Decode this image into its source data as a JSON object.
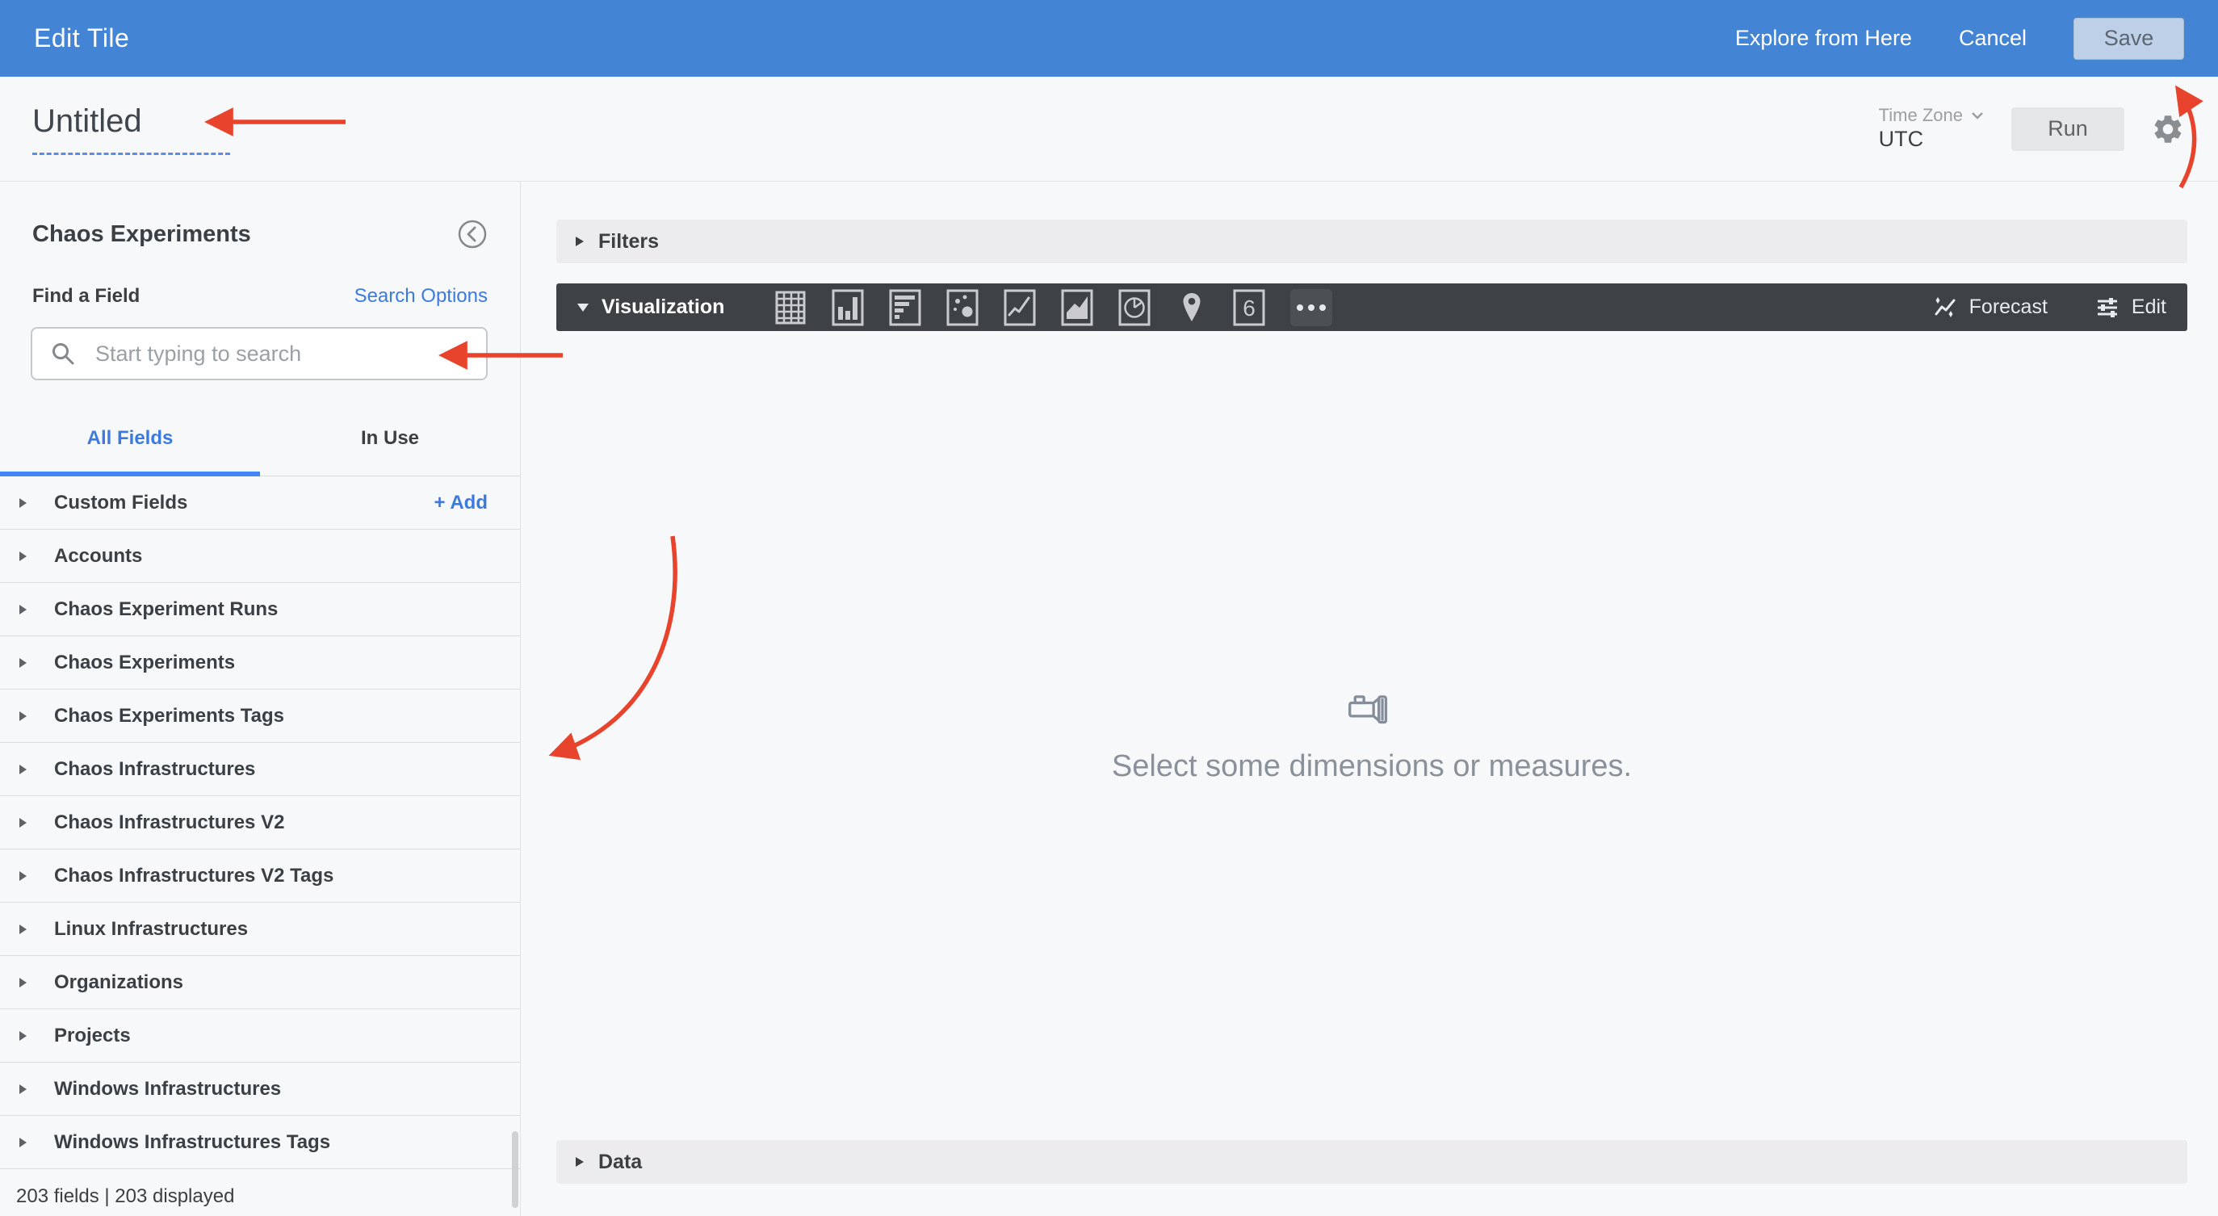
{
  "topbar": {
    "title": "Edit Tile",
    "explore_label": "Explore from Here",
    "cancel_label": "Cancel",
    "save_label": "Save"
  },
  "header": {
    "title": "Untitled",
    "timezone_label": "Time Zone",
    "timezone_value": "UTC",
    "run_label": "Run"
  },
  "sidebar": {
    "title": "Chaos Experiments",
    "find_field_label": "Find a Field",
    "search_options_label": "Search Options",
    "search_placeholder": "Start typing to search",
    "tabs": [
      {
        "label": "All Fields",
        "active": true
      },
      {
        "label": "In Use",
        "active": false
      }
    ],
    "fields": [
      {
        "label": "Custom Fields",
        "action_label": "+ Add"
      },
      {
        "label": "Accounts"
      },
      {
        "label": "Chaos Experiment Runs"
      },
      {
        "label": "Chaos Experiments"
      },
      {
        "label": "Chaos Experiments Tags"
      },
      {
        "label": "Chaos Infrastructures"
      },
      {
        "label": "Chaos Infrastructures V2"
      },
      {
        "label": "Chaos Infrastructures V2 Tags"
      },
      {
        "label": "Linux Infrastructures"
      },
      {
        "label": "Organizations"
      },
      {
        "label": "Projects"
      },
      {
        "label": "Windows Infrastructures"
      },
      {
        "label": "Windows Infrastructures Tags"
      }
    ],
    "footer": "203 fields | 203 displayed"
  },
  "main": {
    "filters_label": "Filters",
    "visualization_label": "Visualization",
    "viz_icon_names": [
      "table-icon",
      "column-chart-icon",
      "bar-chart-icon",
      "scatter-plot-icon",
      "line-chart-icon",
      "area-chart-icon",
      "pie-chart-icon",
      "map-pin-icon",
      "single-value-icon",
      "more-icon"
    ],
    "single_value_glyph": "6",
    "forecast_label": "Forecast",
    "edit_label": "Edit",
    "empty_state": "Select some dimensions or measures.",
    "data_label": "Data"
  },
  "colors": {
    "topbar_blue": "#4484d4",
    "link_blue": "#3d7ae0",
    "tab_underline_blue": "#4285f4",
    "dark_bar": "#3e4247",
    "annotation_red": "#e8432d",
    "page_bg": "#f7f8f9"
  }
}
